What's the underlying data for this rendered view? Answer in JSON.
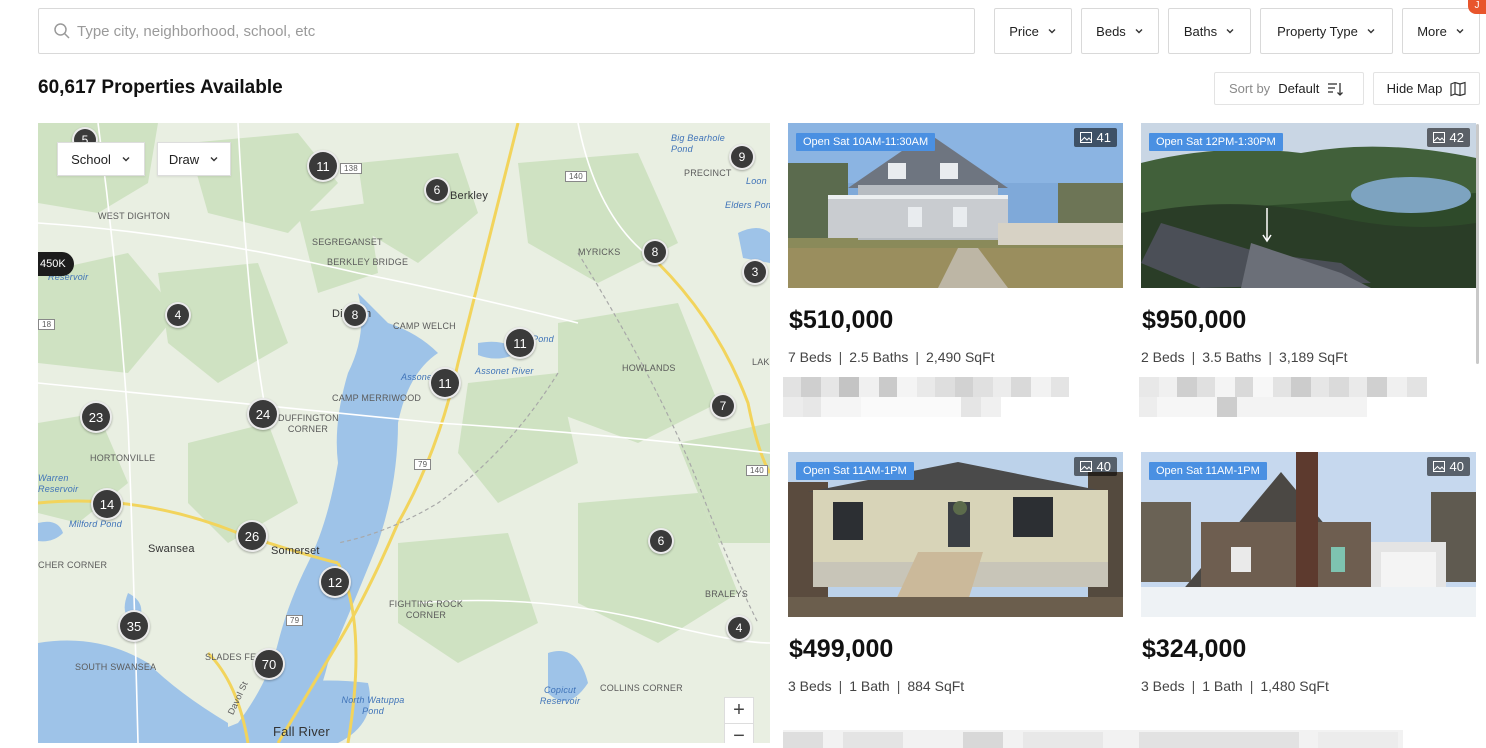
{
  "search": {
    "placeholder": "Type city, neighborhood, school, etc"
  },
  "filters": [
    "Price",
    "Beds",
    "Baths",
    "Property Type",
    "More"
  ],
  "corner_badge": "J",
  "results": {
    "count_label": "60,617 Properties Available"
  },
  "sort": {
    "label": "Sort by",
    "value": "Default"
  },
  "hide_map_label": "Hide Map",
  "map": {
    "buttons": [
      "School",
      "Draw"
    ],
    "price_pin": "450K",
    "clusters": [
      "5",
      "11",
      "6",
      "9",
      "8",
      "3",
      "4",
      "8",
      "11",
      "11",
      "23",
      "24",
      "7",
      "14",
      "26",
      "6",
      "12",
      "35",
      "70",
      "4"
    ],
    "labels": [
      "WEST DIGHTON",
      "SEGREGANSET",
      "BERKLEY BRIDGE",
      "Berkley",
      "Big Bearhole Pond",
      "PRECINCT",
      "Loon",
      "Elders Pond",
      "MYRICKS",
      "Upper Reservoir",
      "CAMP WELCH",
      "Dighton",
      "Assonet",
      "Assonet River",
      "Pond",
      "HOWLANDS",
      "LAKE",
      "CAMP MERRIWOOD",
      "DUFFINGTON CORNER",
      "HORTONVILLE",
      "Warren Reservoir",
      "Milford Pond",
      "Swansea",
      "Somerset",
      "CHER CORNER",
      "FIGHTING ROCK CORNER",
      "BRALEYS",
      "SOUTH SWANSEA",
      "SLADES FE",
      "Davol St",
      "North Watuppa Pond",
      "Copicut Reservoir",
      "COLLINS CORNER",
      "Fall River",
      "138",
      "140",
      "79",
      "79",
      "140",
      "18"
    ],
    "zoom_in": "+",
    "zoom_out": "−"
  },
  "listings": [
    {
      "open_house": "Open Sat 10AM-11:30AM",
      "photos": "41",
      "price": "$510,000",
      "beds": "7 Beds",
      "baths": "2.5 Baths",
      "sqft": "2,490 SqFt"
    },
    {
      "open_house": "Open Sat 12PM-1:30PM",
      "photos": "42",
      "price": "$950,000",
      "beds": "2 Beds",
      "baths": "3.5 Baths",
      "sqft": "3,189 SqFt"
    },
    {
      "open_house": "Open Sat 11AM-1PM",
      "photos": "40",
      "price": "$499,000",
      "beds": "3 Beds",
      "baths": "1 Bath",
      "sqft": "884 SqFt"
    },
    {
      "open_house": "Open Sat 11AM-1PM",
      "photos": "40",
      "price": "$324,000",
      "beds": "3 Beds",
      "baths": "1 Bath",
      "sqft": "1,480 SqFt"
    }
  ],
  "detail_separator": "|",
  "colors": {
    "accent_badge": "#4a90e2",
    "cluster": "#3a3a3a",
    "water": "#9ec3e8",
    "road": "#f2d45c",
    "land": "#eaf0e3",
    "forest": "#cfe2c2"
  }
}
